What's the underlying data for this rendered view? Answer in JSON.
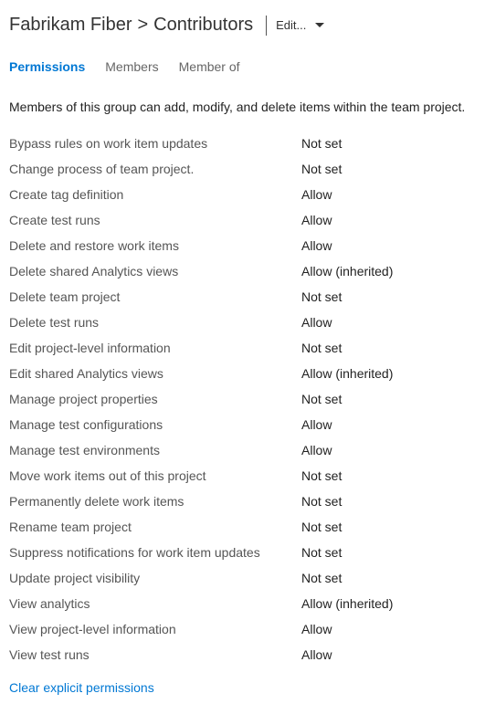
{
  "breadcrumb": {
    "parent": "Fabrikam Fiber",
    "separator": ">",
    "current": "Contributors"
  },
  "edit_dropdown": {
    "label": "Edit..."
  },
  "tabs": [
    {
      "label": "Permissions",
      "active": true
    },
    {
      "label": "Members",
      "active": false
    },
    {
      "label": "Member of",
      "active": false
    }
  ],
  "description": "Members of this group can add, modify, and delete items within the team project.",
  "permissions": [
    {
      "label": "Bypass rules on work item updates",
      "value": "Not set"
    },
    {
      "label": "Change process of team project.",
      "value": "Not set"
    },
    {
      "label": "Create tag definition",
      "value": "Allow"
    },
    {
      "label": "Create test runs",
      "value": "Allow"
    },
    {
      "label": "Delete and restore work items",
      "value": "Allow"
    },
    {
      "label": "Delete shared Analytics views",
      "value": "Allow (inherited)"
    },
    {
      "label": "Delete team project",
      "value": "Not set"
    },
    {
      "label": "Delete test runs",
      "value": "Allow"
    },
    {
      "label": "Edit project-level information",
      "value": "Not set"
    },
    {
      "label": "Edit shared Analytics views",
      "value": "Allow (inherited)"
    },
    {
      "label": "Manage project properties",
      "value": "Not set"
    },
    {
      "label": "Manage test configurations",
      "value": "Allow"
    },
    {
      "label": "Manage test environments",
      "value": "Allow"
    },
    {
      "label": "Move work items out of this project",
      "value": "Not set"
    },
    {
      "label": "Permanently delete work items",
      "value": "Not set"
    },
    {
      "label": "Rename team project",
      "value": "Not set"
    },
    {
      "label": "Suppress notifications for work item updates",
      "value": "Not set"
    },
    {
      "label": "Update project visibility",
      "value": "Not set"
    },
    {
      "label": "View analytics",
      "value": "Allow (inherited)"
    },
    {
      "label": "View project-level information",
      "value": "Allow"
    },
    {
      "label": "View test runs",
      "value": "Allow"
    }
  ],
  "clear_link": "Clear explicit permissions"
}
